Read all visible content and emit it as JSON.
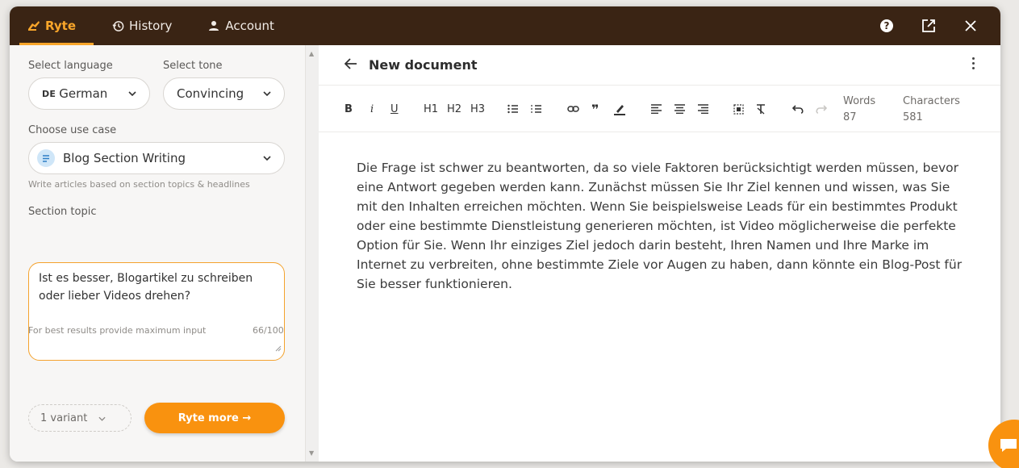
{
  "tabs": [
    {
      "label": "Ryte",
      "icon": "ryte-logo-icon"
    },
    {
      "label": "History",
      "icon": "history-icon"
    },
    {
      "label": "Account",
      "icon": "user-icon"
    }
  ],
  "topbar_icons": [
    "help-icon",
    "open-external-icon",
    "close-icon"
  ],
  "left": {
    "language_label": "Select language",
    "language_code": "DE",
    "language_value": "German",
    "tone_label": "Select tone",
    "tone_value": "Convincing",
    "usecase_label": "Choose use case",
    "usecase_value": "Blog Section Writing",
    "usecase_hint": "Write articles based on section topics & headlines",
    "topic_label": "Section topic",
    "topic_value": "Ist es besser, Blogartikel zu schreiben oder lieber Videos drehen?",
    "input_hint": "For best results provide maximum input",
    "char_count": "66/100",
    "variant_value": "1 variant",
    "cta_label": "Ryte more →"
  },
  "editor": {
    "title": "New document",
    "toolbar": {
      "bold": "B",
      "italic": "i",
      "underline": "U",
      "h1": "H1",
      "h2": "H2",
      "h3": "H3"
    },
    "words_label": "Words",
    "words_value": "87",
    "chars_label": "Characters",
    "chars_value": "581",
    "content": "Die Frage ist schwer zu beantworten, da so viele Faktoren berücksichtigt werden müssen, bevor eine Antwort gegeben werden kann. Zunächst müssen Sie Ihr Ziel kennen und wissen, was Sie mit den Inhalten erreichen möchten. Wenn Sie beispielsweise Leads für ein bestimmtes Produkt oder eine bestimmte Dienstleistung generieren möchten, ist Video möglicherweise die perfekte Option für Sie. Wenn Ihr einziges Ziel jedoch darin besteht, Ihren Namen und Ihre Marke im Internet zu verbreiten, ohne bestimmte Ziele vor Augen zu haben, dann könnte ein Blog-Post für Sie besser funktionieren."
  },
  "colors": {
    "topbar": "#3a2414",
    "accent": "#f9a62a",
    "cta": "#f9920f"
  }
}
